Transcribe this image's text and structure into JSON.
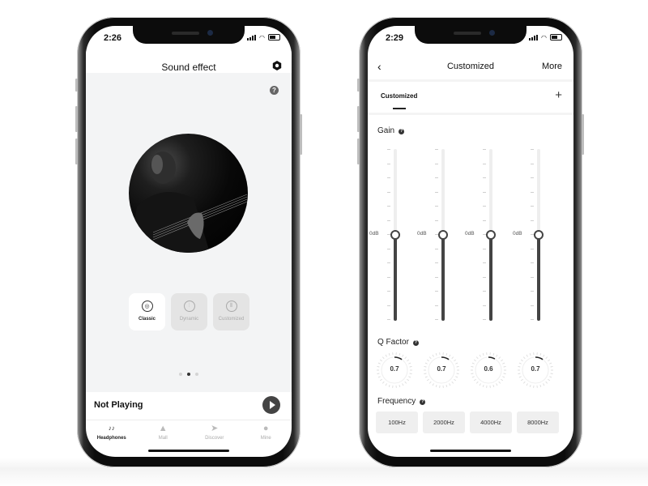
{
  "left_phone": {
    "status": {
      "time": "2:26"
    },
    "header": {
      "title": "Sound effect",
      "settings_icon": "hexagon-settings-icon"
    },
    "help_icon": "?",
    "album_art": {
      "description": "Black and white photo of a man playing guitar"
    },
    "modes": [
      {
        "label": "Classic",
        "icon": "disc-icon",
        "glyph": "◎",
        "active": true
      },
      {
        "label": "Dynamic",
        "icon": "waveform-icon",
        "glyph": "⫶",
        "active": false
      },
      {
        "label": "Customized",
        "icon": "equalizer-icon",
        "glyph": "⫴",
        "active": false
      }
    ],
    "pager": {
      "count": 3,
      "current": 2
    },
    "player": {
      "status": "Not Playing",
      "play_icon": "play-icon"
    },
    "tabs": [
      {
        "label": "Headphones",
        "icon": "headphones-icon",
        "glyph": "♪♪",
        "active": true
      },
      {
        "label": "Mall",
        "icon": "shopping-bag-icon",
        "glyph": "▲",
        "active": false
      },
      {
        "label": "Discover",
        "icon": "paper-plane-icon",
        "glyph": "➤",
        "active": false
      },
      {
        "label": "Mine",
        "icon": "person-icon",
        "glyph": "●",
        "active": false
      }
    ]
  },
  "right_phone": {
    "status": {
      "time": "2:29"
    },
    "header": {
      "back": "‹",
      "title": "Customized",
      "more": "More"
    },
    "preset_tab": {
      "label": "Customized",
      "add": "+"
    },
    "gain": {
      "title": "Gain",
      "help": "?",
      "bands": [
        {
          "label": "0dB",
          "value_db": 0
        },
        {
          "label": "0dB",
          "value_db": 0
        },
        {
          "label": "0dB",
          "value_db": 0
        },
        {
          "label": "0dB",
          "value_db": 0
        }
      ]
    },
    "q_factor": {
      "title": "Q Factor",
      "help": "?",
      "values": [
        "0.7",
        "0.7",
        "0.6",
        "0.7"
      ]
    },
    "frequency": {
      "title": "Frequency",
      "help": "?",
      "values": [
        "100Hz",
        "2000Hz",
        "4000Hz",
        "8000Hz"
      ]
    }
  }
}
